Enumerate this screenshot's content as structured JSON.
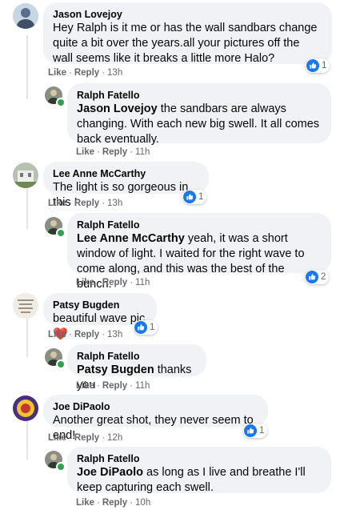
{
  "actions": {
    "like": "Like",
    "reply": "Reply",
    "sep": "·"
  },
  "colors": {
    "like_blue": "#1877f2",
    "text_secondary": "#65676b",
    "bubble_bg": "#f0f2f5",
    "online_green": "#31a24c"
  },
  "comments": [
    {
      "author": "Jason Lovejoy",
      "text": "Hey Ralph is it me or has the wall sandbars change quite a bit over the years.all your pictures off the wall seems like it breaks a little more Halo?",
      "time": "13h",
      "reaction": {
        "icon": "like-icon",
        "count": "1"
      },
      "reply": {
        "author": "Ralph Fatello",
        "mention": "Jason Lovejoy",
        "text": " the sandbars are always changing. With each new big swell. It all comes back eventually.",
        "time": "11h"
      }
    },
    {
      "author": "Lee Anne McCarthy",
      "text": "The light is so gorgeous in this !",
      "time": "13h",
      "reaction": {
        "icon": "like-icon",
        "count": "1"
      },
      "reply": {
        "author": "Ralph Fatello",
        "mention": "Lee Anne McCarthy",
        "text": " yeah, it was a short window of light. I waited for the right wave to come along, and this was the best of the bunch.",
        "time": "11h",
        "reaction": {
          "icon": "like-icon",
          "count": "2"
        }
      }
    },
    {
      "author": "Patsy Bugden",
      "text": "beautiful wave pic",
      "text_emoji": "❤️",
      "time": "13h",
      "reaction": {
        "icon": "like-icon",
        "count": "1"
      },
      "reply": {
        "author": "Ralph Fatello",
        "mention": "Patsy Bugden",
        "text": " thanks you",
        "time": "11h"
      }
    },
    {
      "author": "Joe DiPaolo",
      "text": "Another great shot, they never seem to end!",
      "time": "12h",
      "reaction": {
        "icon": "like-icon",
        "count": "1"
      },
      "reply": {
        "author": "Ralph Fatello",
        "mention": "Joe DiPaolo",
        "text": " as long as I live and breathe I'll keep capturing each swell.",
        "time": "10h"
      }
    }
  ]
}
